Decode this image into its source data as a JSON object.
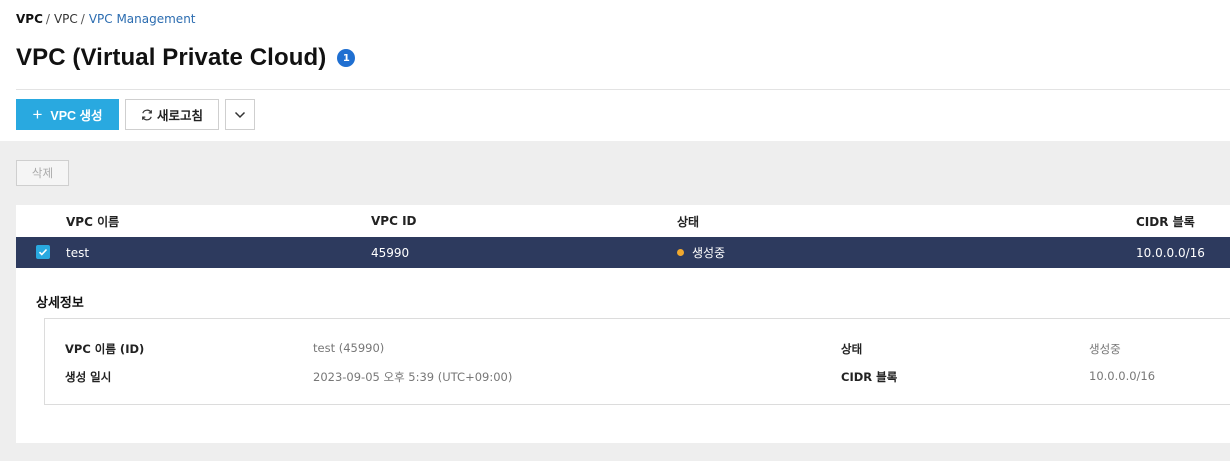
{
  "breadcrumb": {
    "item1": "VPC",
    "item2": "VPC",
    "item3": "VPC Management",
    "sep": "/"
  },
  "page": {
    "title": "VPC (Virtual Private Cloud)",
    "badge_count": "1"
  },
  "toolbar": {
    "create_label": "VPC 생성",
    "refresh_label": "새로고침"
  },
  "actions": {
    "delete_label": "삭제"
  },
  "table": {
    "headers": {
      "name": "VPC 이름",
      "id": "VPC ID",
      "status": "상태",
      "cidr": "CIDR 블록"
    },
    "rows": [
      {
        "name": "test",
        "id": "45990",
        "status": "생성중",
        "cidr": "10.0.0.0/16",
        "selected": true
      }
    ]
  },
  "detail": {
    "title": "상세정보",
    "name_label": "VPC 이름 (ID)",
    "name_value": "test (45990)",
    "created_label": "생성 일시",
    "created_value": "2023-09-05 오후 5:39 (UTC+09:00)",
    "status_label": "상태",
    "status_value": "생성중",
    "cidr_label": "CIDR 블록",
    "cidr_value": "10.0.0.0/16"
  },
  "colors": {
    "primary": "#29a9e0",
    "selected_row": "#2d3a5e",
    "status_dot": "#f0a82e",
    "badge": "#1f6fd1",
    "link": "#2b6cb0"
  },
  "icons": {
    "create": "plus-icon",
    "refresh": "refresh-icon",
    "more": "chevron-down-icon",
    "row_check": "checkbox-checked-icon",
    "status": "status-dot-icon"
  }
}
